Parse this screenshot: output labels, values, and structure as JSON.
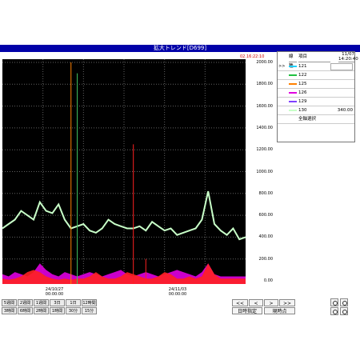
{
  "window": {
    "title": "拡大トレンド[D699]"
  },
  "time_marker": "02.16:22:10",
  "y_axis": {
    "ticks": [
      "2000.00",
      "1800.00",
      "1600.00",
      "1400.00",
      "1200.00",
      "1000.00",
      "800.00",
      "600.00",
      "400.00",
      "200.00",
      "0.00"
    ]
  },
  "x_axis": {
    "labels": [
      {
        "line1": "24/10/27",
        "line2": "00:00:00"
      },
      {
        "line1": "24/11/03",
        "line2": "00:00:00"
      }
    ]
  },
  "legend": {
    "col_type": "線種",
    "col_item": "項目",
    "date": "11/07",
    "time": "14:20:40",
    "items": [
      {
        "label": "121",
        "color": "#20d0ff"
      },
      {
        "label": "122",
        "color": "#20c040"
      },
      {
        "label": "125",
        "color": "#ff8000"
      },
      {
        "label": "126",
        "color": "#e000e0"
      },
      {
        "label": "129",
        "color": "#8040ff"
      },
      {
        "label": "130",
        "color": "#c8ffc8",
        "value": "340.00"
      }
    ],
    "all_axis": "全軸選択",
    "marker": ">>"
  },
  "range_buttons_row1": [
    "5週間",
    "2週間",
    "1週間",
    "3日",
    "1日",
    "12時間"
  ],
  "range_buttons_row2": [
    "3時間",
    "6時間",
    "2時間",
    "1時間",
    "30分",
    "15分"
  ],
  "nav": {
    "first": "<<",
    "prev": "<",
    "next": ">",
    "last": ">>",
    "date_set": "日時指定",
    "now": "現時点"
  },
  "chart_data": {
    "type": "line",
    "ylim": [
      0,
      2000
    ],
    "x_labels": [
      "24/10/27 00:00:00",
      "24/11/03 00:00:00"
    ],
    "series": [
      {
        "name": "130",
        "values": [
          480,
          520,
          560,
          640,
          600,
          560,
          720,
          640,
          620,
          700,
          560,
          480,
          500,
          520,
          460,
          440,
          480,
          560,
          520,
          500,
          480,
          480,
          500,
          460,
          540,
          500,
          460,
          480,
          420,
          440,
          460,
          480,
          560,
          820,
          520,
          460,
          420,
          480,
          380,
          400
        ]
      },
      {
        "name": "126",
        "values": [
          60,
          40,
          80,
          60,
          40,
          80,
          160,
          100,
          60,
          40,
          80,
          60,
          40,
          60,
          80,
          60,
          40,
          60,
          80,
          100,
          60,
          40,
          60,
          80,
          60,
          40,
          60,
          80,
          100,
          80,
          60,
          40,
          80,
          160,
          60,
          40,
          40,
          40,
          40,
          40
        ]
      },
      {
        "name": "125",
        "values": [
          20,
          10,
          20,
          40,
          80,
          100,
          80,
          40,
          20,
          10,
          20,
          10,
          20,
          20,
          40,
          80,
          40,
          20,
          20,
          40,
          80,
          60,
          40,
          20,
          20,
          40,
          80,
          60,
          20,
          20,
          40,
          20,
          40,
          160,
          60,
          20,
          20,
          20,
          20,
          20
        ]
      }
    ],
    "spikes": [
      {
        "series": "125",
        "index": 11,
        "value": 2000
      },
      {
        "series": "122",
        "index": 12,
        "value": 1900
      },
      {
        "series": "126",
        "index": 21,
        "value": 1250
      },
      {
        "series": "126",
        "index": 23,
        "value": 200
      }
    ]
  }
}
